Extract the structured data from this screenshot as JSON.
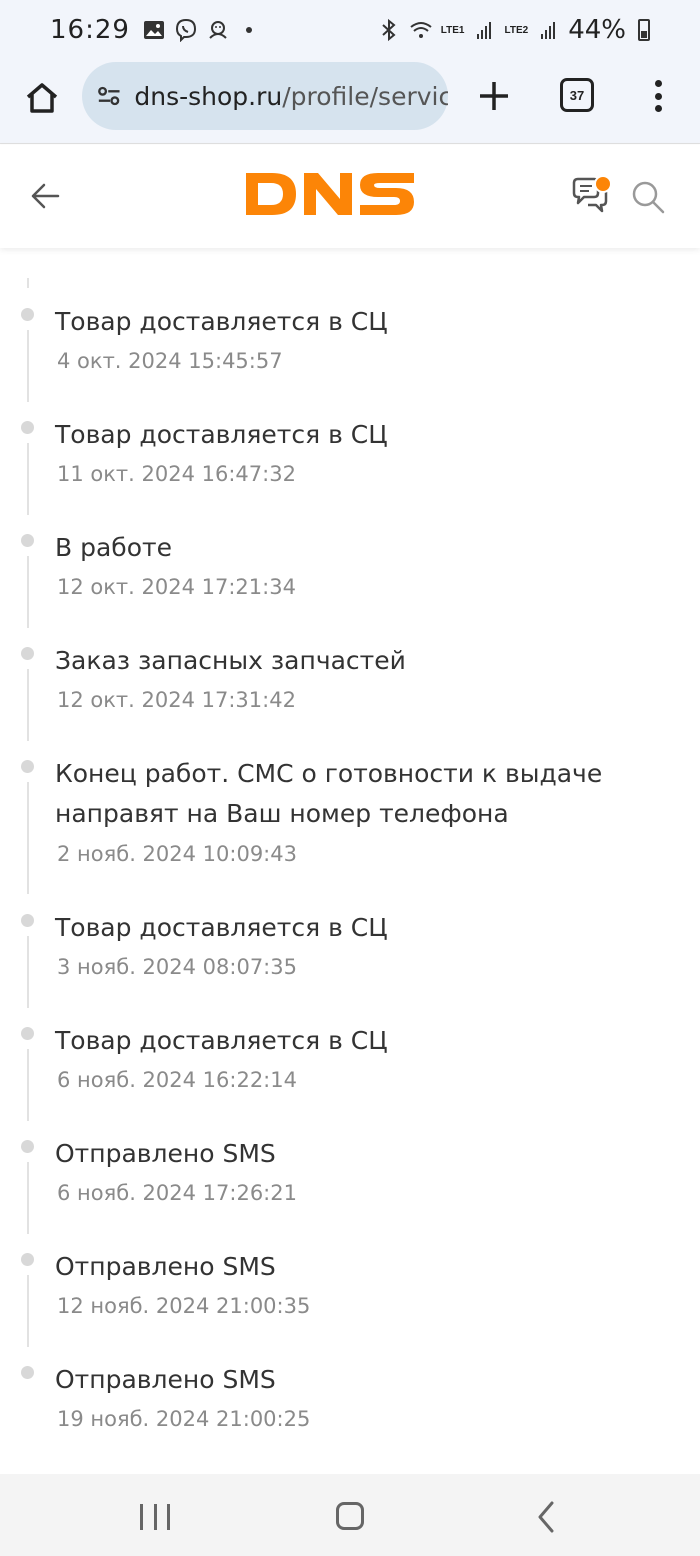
{
  "status_bar": {
    "time": "16:29",
    "battery": "44%",
    "network_labels": [
      "LTE1",
      "LTE2"
    ]
  },
  "browser": {
    "url_domain": "dns-shop.ru",
    "url_path": "/profile/service",
    "tabs_count": "37"
  },
  "header": {
    "logo": "DNS",
    "logo_color": "#fc8507"
  },
  "timeline": {
    "items": [
      {
        "title": "Товар доставляется в СЦ",
        "date": "4 окт. 2024 15:45:57"
      },
      {
        "title": "Товар доставляется в СЦ",
        "date": "11 окт. 2024 16:47:32"
      },
      {
        "title": "В работе",
        "date": "12 окт. 2024 17:21:34"
      },
      {
        "title": "Заказ запасных запчастей",
        "date": "12 окт. 2024 17:31:42"
      },
      {
        "title": "Конец работ. СМС о готовности к выдаче направят на Ваш номер телефона",
        "date": "2 нояб. 2024 10:09:43"
      },
      {
        "title": "Товар доставляется в СЦ",
        "date": "3 нояб. 2024 08:07:35"
      },
      {
        "title": "Товар доставляется в СЦ",
        "date": "6 нояб. 2024 16:22:14"
      },
      {
        "title": "Отправлено SMS",
        "date": "6 нояб. 2024 17:26:21"
      },
      {
        "title": "Отправлено SMS",
        "date": "12 нояб. 2024 21:00:35"
      },
      {
        "title": "Отправлено SMS",
        "date": "19 нояб. 2024 21:00:25"
      }
    ]
  }
}
